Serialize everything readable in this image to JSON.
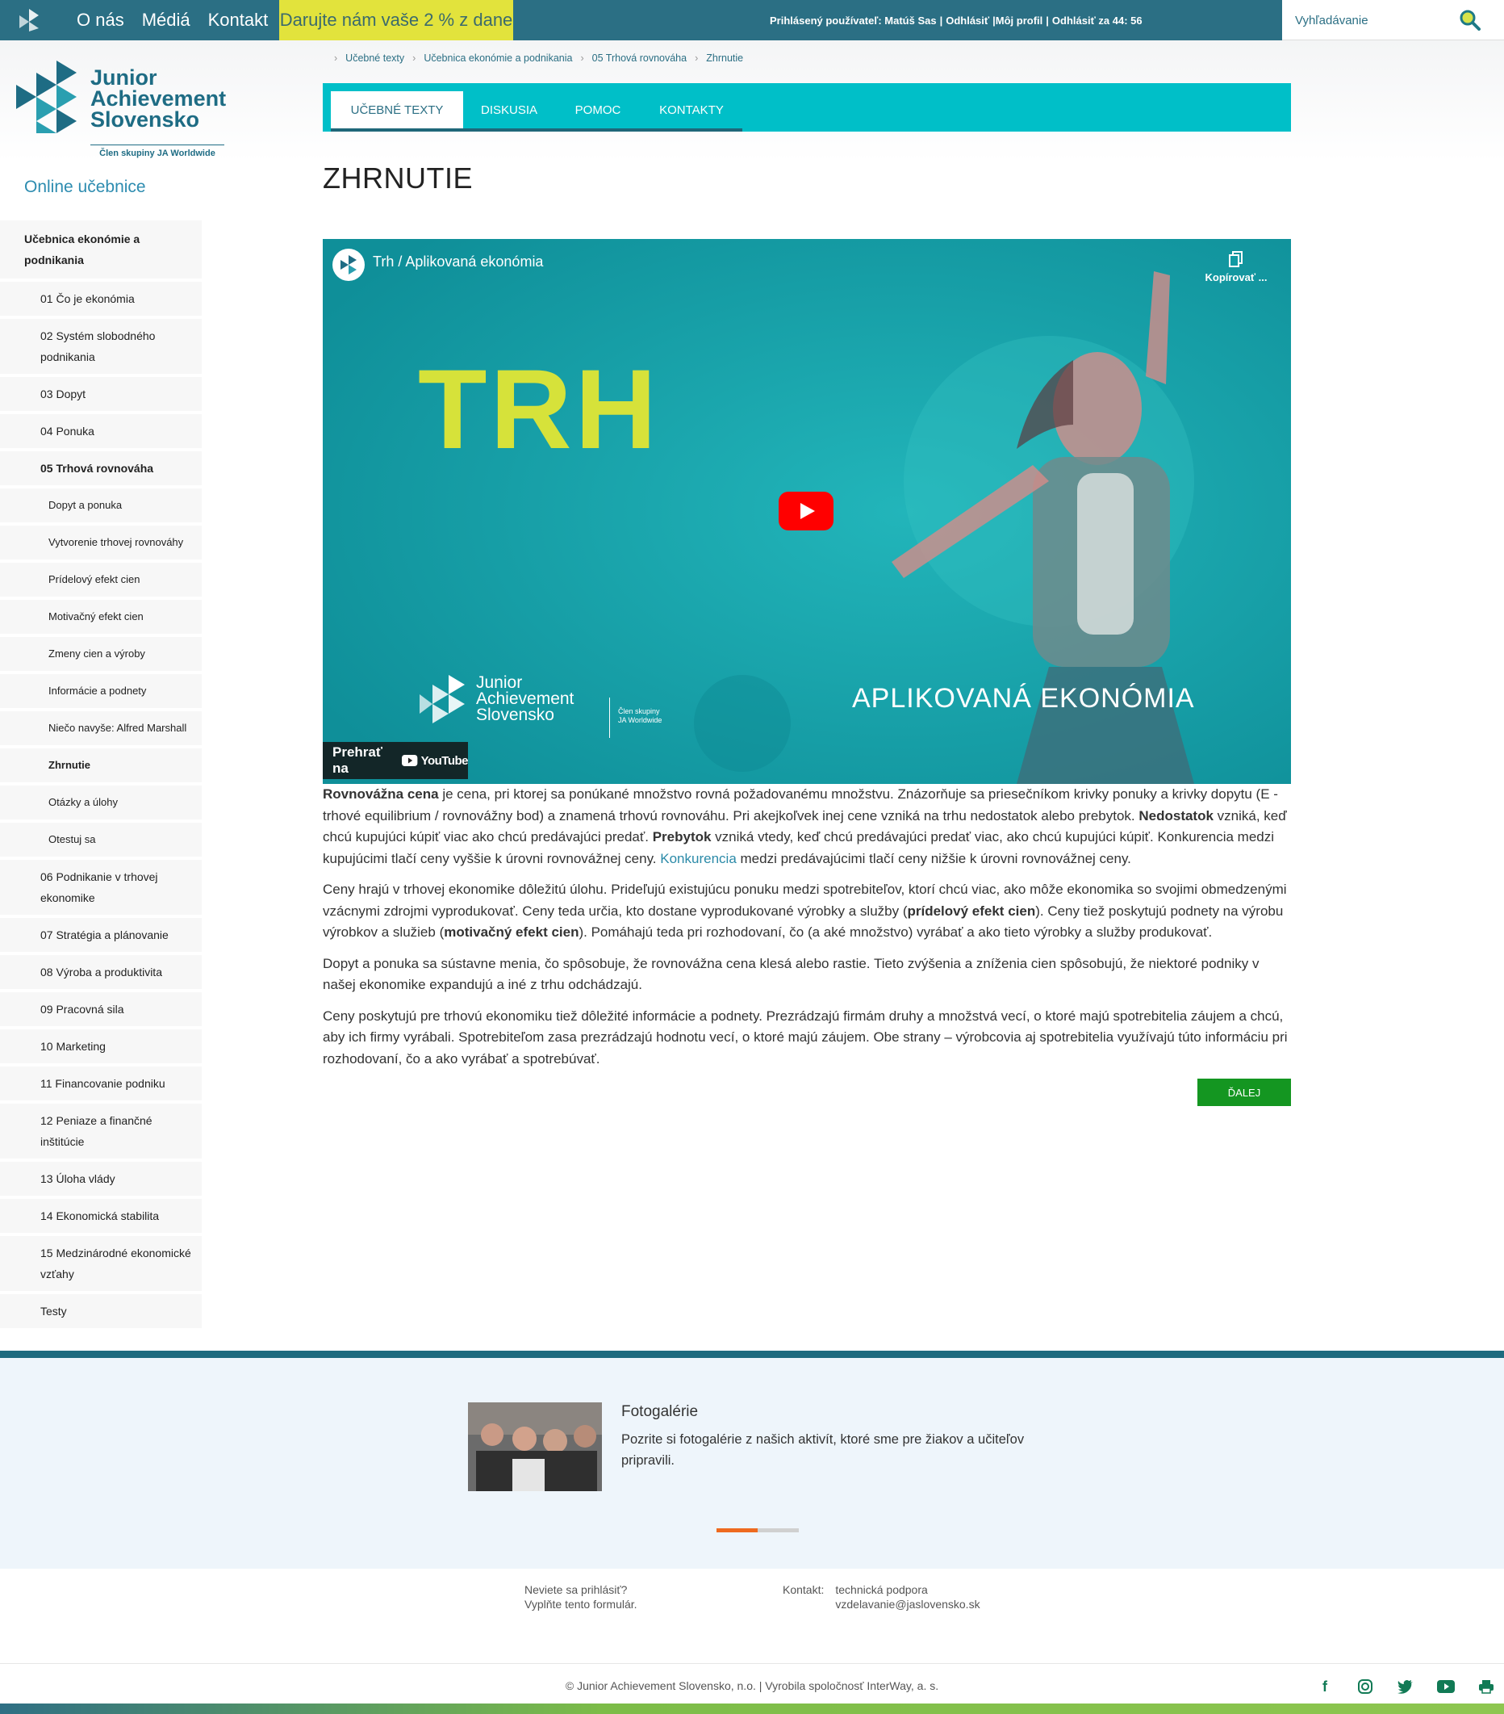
{
  "topbar": {
    "nav": [
      "O nás",
      "Médiá",
      "Kontakt"
    ],
    "donate": "Darujte nám vaše 2 % z dane",
    "user_parts": [
      "Prihlásený používateľ: Matúš Sas",
      "|",
      "Odhlásiť",
      "|Môj profil",
      "|",
      "Odhlásiť za 44: 56"
    ],
    "search_placeholder": "Vyhľadávanie"
  },
  "brand": {
    "name_lines": [
      "Junior",
      "Achievement",
      "Slovensko"
    ],
    "sub": "Člen skupiny JA Worldwide"
  },
  "online_title": "Online učebnice",
  "sidebar": {
    "book": "Učebnica ekonómie a podnikania",
    "chapters_before": [
      "01 Čo je ekonómia",
      "02 Systém slobodného podnikania",
      "03 Dopyt",
      "04 Ponuka"
    ],
    "active_chapter": "05 Trhová rovnováha",
    "subitems": [
      "Dopyt a ponuka",
      "Vytvorenie trhovej rovnováhy",
      "Prídelový efekt cien",
      "Motivačný efekt cien",
      "Zmeny cien a výroby",
      "Informácie a podnety",
      "Niečo navyše: Alfred Marshall",
      "Zhrnutie",
      "Otázky a úlohy",
      "Otestuj sa"
    ],
    "active_sub": "Zhrnutie",
    "chapters_after": [
      "06 Podnikanie v trhovej ekonomike",
      "07 Stratégia a plánovanie",
      "08 Výroba a produktivita",
      "09 Pracovná sila",
      "10 Marketing",
      "11 Financovanie podniku",
      "12 Peniaze a finančné inštitúcie",
      "13 Úloha vlády",
      "14 Ekonomická stabilita",
      "15 Medzinárodné ekonomické vzťahy",
      "Testy"
    ]
  },
  "breadcrumb": [
    "Učebné texty",
    "Učebnica ekonómie a podnikania",
    "05 Trhová rovnováha",
    "Zhrnutie"
  ],
  "tabs": [
    "UČEBNÉ TEXTY",
    "DISKUSIA",
    "POMOC",
    "KONTAKTY"
  ],
  "page_title": "ZHRNUTIE",
  "video": {
    "title": "Trh / Aplikovaná ekonómia",
    "copy_label": "Kopírovať ...",
    "big_word": "TRH",
    "caption": "APLIKOVANÁ EKONÓMIA",
    "watch_label": "Prehrať na",
    "youtube_label": "YouTube",
    "brand_lines": [
      "Junior",
      "Achievement",
      "Slovensko"
    ],
    "brand_member": [
      "Člen skupiny",
      "JA Worldwide"
    ]
  },
  "content": {
    "p1": {
      "b1": "Rovnovážna cena",
      "t1": " je cena, pri ktorej sa ponúkané množstvo rovná požadovanému množstvu. Znázorňuje sa priesečníkom krivky ponuky a krivky dopytu (E - trhové equilibrium / rovnovážny bod) a znamená trhovú rovnováhu. Pri akejkoľvek inej cene vzniká na trhu nedostatok alebo prebytok. ",
      "b2": "Nedostatok",
      "t2": " vzniká, keď chcú kupujúci kúpiť viac ako chcú predávajúci predať. ",
      "b3": "Prebytok",
      "t3": " vzniká vtedy, keď chcú predávajúci predať viac, ako chcú kupujúci kúpiť. Konkurencia medzi kupujúcimi tlačí ceny vyššie k úrovni rovnovážnej ceny. ",
      "link": "Konkurencia",
      "t4": " medzi predávajúcimi tlačí ceny nižšie k úrovni rovnovážnej ceny."
    },
    "p2": {
      "t1": "Ceny hrajú v trhovej ekonomike dôležitú úlohu. Prideľujú existujúcu ponuku medzi spotrebiteľov, ktorí chcú viac, ako môže ekonomika so svojimi obmedzenými vzácnymi zdrojmi vyprodukovať. Ceny teda určia, kto dostane vyprodukované výrobky a služby (",
      "b1": "prídelový efekt cien",
      "t2": "). Ceny tiež poskytujú podnety na výrobu výrobkov a služieb (",
      "b2": "motivačný efekt cien",
      "t3": "). Pomáhajú teda pri rozhodovaní, čo (a aké množstvo) vyrábať a ako tieto výrobky a služby produkovať."
    },
    "p3": "Dopyt a ponuka sa sústavne menia, čo spôsobuje, že rovnovážna cena klesá alebo rastie. Tieto zvýšenia a zníženia cien spôsobujú, že niektoré podniky v našej ekonomike expandujú a iné z trhu odchádzajú.",
    "p4": "Ceny poskytujú pre trhovú ekonomiku tiež dôležité informácie a podnety. Prezrádzajú firmám druhy a množstvá vecí, o ktoré majú spotrebitelia záujem a chcú, aby ich firmy vyrábali. Spotrebiteľom zasa prezrádzajú hodnotu vecí, o ktoré majú záujem. Obe strany – výrobcovia aj spotrebitelia využívajú túto informáciu pri rozhodovaní, čo a ako vyrábať a spotrebúvať.",
    "next": "ĎALEJ"
  },
  "gallery": {
    "title": "Fotogalérie",
    "desc": "Pozrite si fotogalérie z našich aktivít, ktoré sme pre žiakov a učiteľov pripravili.",
    "progress": 0.5
  },
  "footer": {
    "login_q": "Neviete sa prihlásiť?",
    "login_form": "Vyplňte tento formulár.",
    "contact_label": "Kontakt:",
    "contact_lines": [
      "technická podpora",
      "vzdelavanie@jaslovensko.sk"
    ],
    "copyright": "© Junior Achievement Slovensko, n.o. | Vyrobila spoločnosť InterWay, a. s.",
    "socials": [
      "facebook-icon",
      "instagram-icon",
      "twitter-icon",
      "youtube-icon",
      "print-icon"
    ]
  },
  "colors": {
    "topbar": "#2b6f84",
    "accent_tabs": "#00bfc8",
    "donate": "#e2e33c",
    "next_button": "#149621",
    "brand": "#1e6c84"
  }
}
